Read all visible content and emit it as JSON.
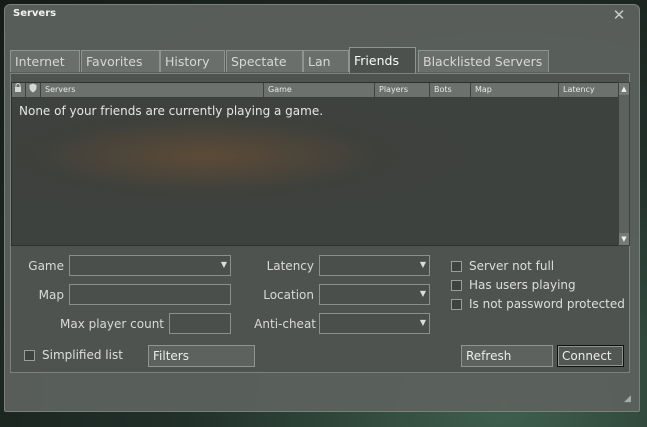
{
  "window": {
    "title": "Servers"
  },
  "tabs": [
    {
      "label": "Internet"
    },
    {
      "label": "Favorites"
    },
    {
      "label": "History"
    },
    {
      "label": "Spectate"
    },
    {
      "label": "Lan"
    },
    {
      "label": "Friends",
      "active": true
    },
    {
      "label": "Blacklisted Servers"
    }
  ],
  "list": {
    "columns": [
      "Servers",
      "Game",
      "Players",
      "Bots",
      "Map",
      "Latency"
    ],
    "empty_message": "None of your friends are currently playing a game.",
    "lock_icon": "lock-icon",
    "vac_icon": "shield-icon"
  },
  "filters": {
    "game_label": "Game",
    "game_value": "",
    "map_label": "Map",
    "map_value": "",
    "max_player_label": "Max player count",
    "max_player_value": "",
    "latency_label": "Latency",
    "latency_value": "",
    "location_label": "Location",
    "location_value": "",
    "anticheat_label": "Anti-cheat",
    "anticheat_value": "",
    "server_not_full": "Server not full",
    "has_users_playing": "Has users playing",
    "not_password_protected": "Is not password protected"
  },
  "footer": {
    "simplified_list": "Simplified list",
    "filters_button": "Filters",
    "refresh_button": "Refresh",
    "connect_button": "Connect"
  }
}
